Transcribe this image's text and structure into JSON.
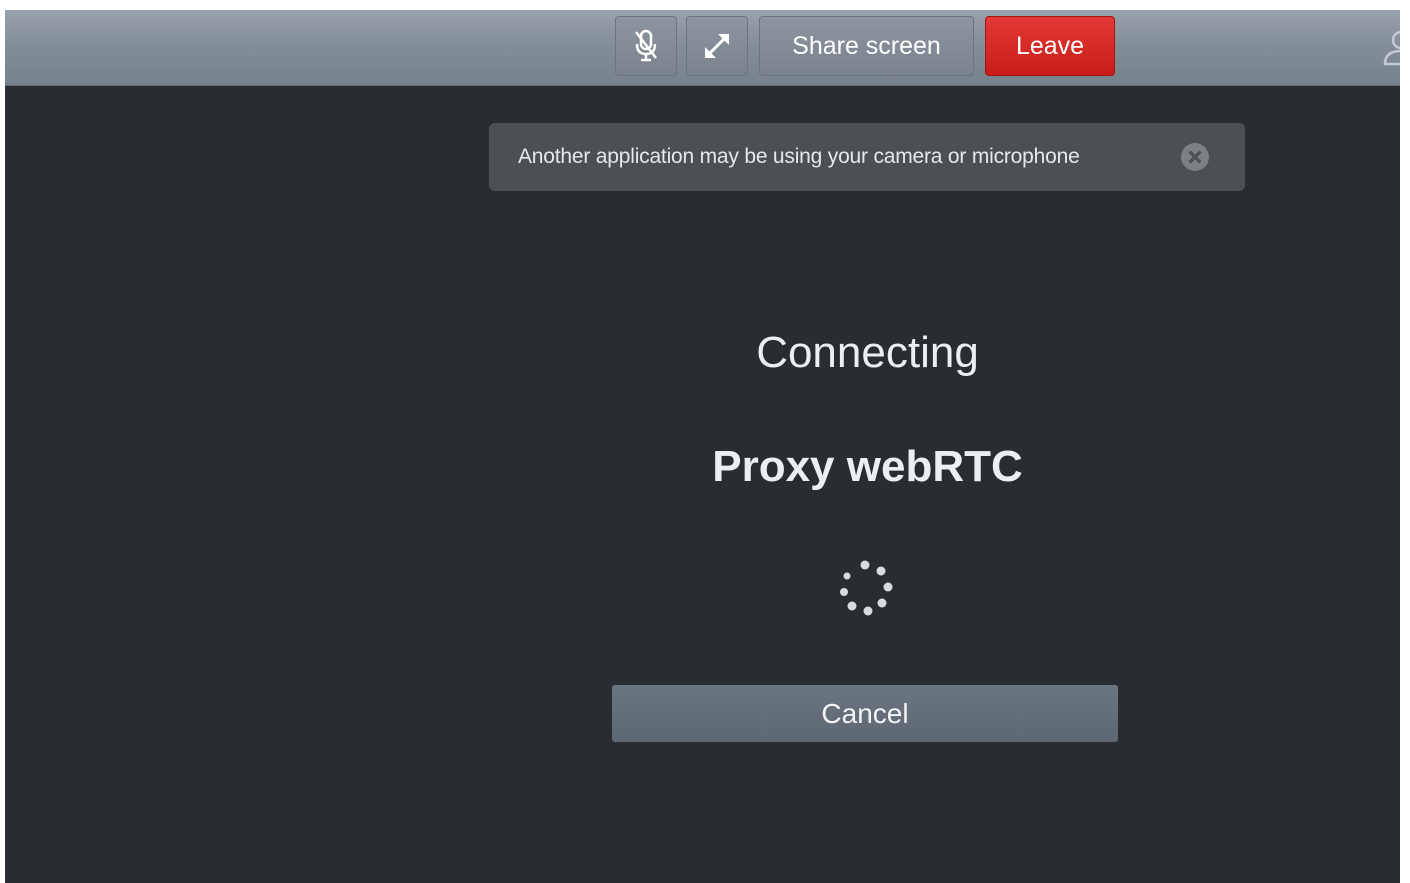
{
  "toolbar": {
    "mute_icon": "microphone-muted-icon",
    "fullscreen_icon": "expand-icon",
    "share_label": "Share screen",
    "leave_label": "Leave",
    "user_icon": "user-icon",
    "leave_color": "#d9231f"
  },
  "notice": {
    "text": "Another application may be using your camera or microphone",
    "close_icon": "close-circle-icon"
  },
  "status": {
    "connecting": "Connecting",
    "target": "Proxy webRTC",
    "spinner_icon": "loading-spinner-icon"
  },
  "actions": {
    "cancel_label": "Cancel"
  },
  "colors": {
    "background": "#292d32",
    "toolbar": "#858f9a",
    "notice_bg": "#4c5054",
    "cancel_bg": "#646e79"
  }
}
